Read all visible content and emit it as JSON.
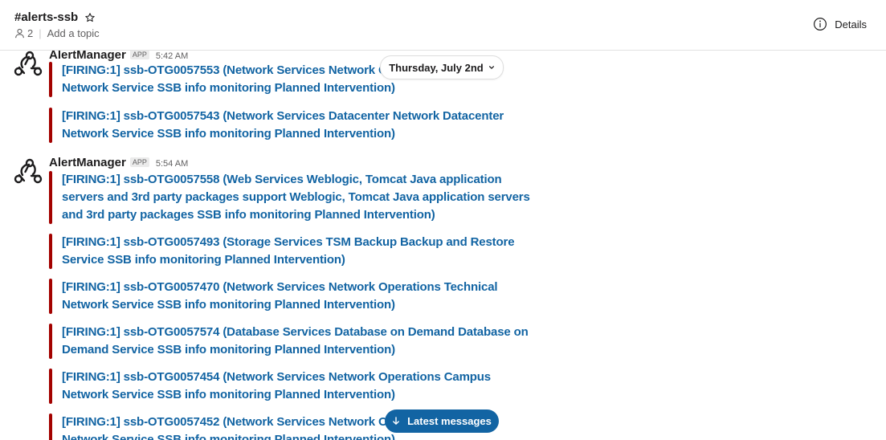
{
  "header": {
    "channel_name": "#alerts-ssb",
    "member_count": "2",
    "add_topic": "Add a topic",
    "details_label": "Details"
  },
  "date_divider": {
    "label": "Thursday, July 2nd"
  },
  "messages": [
    {
      "sender": "AlertManager",
      "badge": "APP",
      "time": "5:42 AM",
      "attachments": [
        {
          "lines": [
            "[FIRING:1] ssb-OTG0057553 (Network Services Network Op",
            "Network Service SSB info monitoring Planned Intervention)"
          ]
        },
        {
          "lines": [
            "[FIRING:1] ssb-OTG0057543 (Network Services Datacenter Network Datacenter",
            "Network Service SSB info monitoring Planned Intervention)"
          ]
        }
      ]
    },
    {
      "sender": "AlertManager",
      "badge": "APP",
      "time": "5:54 AM",
      "attachments": [
        {
          "lines": [
            "[FIRING:1] ssb-OTG0057558 (Web Services Weblogic, Tomcat Java application",
            "servers and 3rd party packages support Weblogic, Tomcat Java application servers",
            "and 3rd party packages SSB info monitoring Planned Intervention)"
          ]
        },
        {
          "lines": [
            "[FIRING:1] ssb-OTG0057493 (Storage Services TSM Backup Backup and Restore",
            "Service SSB info monitoring Planned Intervention)"
          ]
        },
        {
          "lines": [
            "[FIRING:1] ssb-OTG0057470 (Network Services Network Operations Technical",
            "Network Service SSB info monitoring Planned Intervention)"
          ]
        },
        {
          "lines": [
            "[FIRING:1] ssb-OTG0057574 (Database Services Database on Demand Database on",
            "Demand Service SSB info monitoring Planned Intervention)"
          ]
        },
        {
          "lines": [
            "[FIRING:1] ssb-OTG0057454 (Network Services Network Operations Campus",
            "Network Service SSB info monitoring Planned Intervention)"
          ]
        },
        {
          "lines": [
            "[FIRING:1] ssb-OTG0057452 (Network Services Network Op",
            "Network Service SSB info monitoring Planned Intervention)"
          ]
        }
      ]
    }
  ],
  "latest_button": {
    "label": "Latest messages"
  },
  "colors": {
    "link": "#1264a3",
    "alert_bar": "#a30200",
    "button": "#1264a3"
  }
}
